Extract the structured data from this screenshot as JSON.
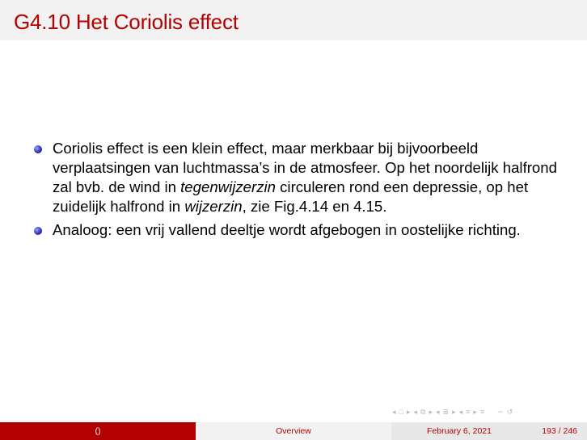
{
  "title": "G4.10 Het Coriolis effect",
  "bullets": [
    {
      "parts": [
        "Coriolis effect is een klein effect, maar merkbaar bij bijvoorbeeld verplaatsingen van luchtmassa’s in de atmosfeer. Op het noordelijk halfrond zal bvb. de wind in ",
        "tegenwijzerzin",
        " circuleren rond een depressie, op het zuidelijk halfrond in ",
        "wijzerzin",
        ", zie Fig.4.14 en 4.15."
      ]
    },
    {
      "text": "Analoog: een vrij vallend deeltje wordt afgebogen in oostelijke richting."
    }
  ],
  "nav": {
    "left_arrow": "◂",
    "right_arrow": "▸",
    "frame_icon": "□",
    "subsection_icon": "⧉",
    "section_icon": "≣",
    "menu_icon": "≡",
    "search_icon": "∽",
    "back_icon": "↺",
    "eq_icon": "≡"
  },
  "footer": {
    "author": "()",
    "section": "Overview",
    "date": "February 6, 2021",
    "pages": "193 / 246"
  }
}
